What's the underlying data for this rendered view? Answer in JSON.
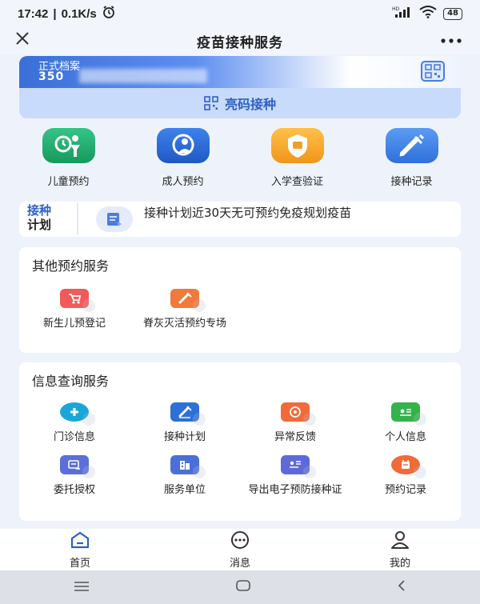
{
  "status": {
    "time": "17:42",
    "speed": "0.1K/s",
    "network": "HD",
    "battery": "48"
  },
  "nav": {
    "title": "疫苗接种服务"
  },
  "qr_card": {
    "archive_label": "正式档案",
    "archive_id": "350",
    "action_label": "亮码接种"
  },
  "main_services": [
    {
      "label": "儿童预约",
      "color": "#1fa86b"
    },
    {
      "label": "成人预约",
      "color": "#2c6fd6"
    },
    {
      "label": "入学查验证",
      "color": "#f2a623"
    },
    {
      "label": "接种记录",
      "color": "#3d86e8"
    }
  ],
  "plan": {
    "badge_line1": "接种",
    "badge_line2": "计划",
    "text": "接种计划近30天无可预约免疫规划疫苗"
  },
  "other_services": {
    "title": "其他预约服务",
    "items": [
      {
        "label": "新生儿预登记",
        "color": "#f25a5a"
      },
      {
        "label": "脊灰灭活预约专场",
        "color": "#f07a3a"
      }
    ]
  },
  "info_services": {
    "title": "信息查询服务",
    "items": [
      {
        "label": "门诊信息",
        "color": "#1aa6d9"
      },
      {
        "label": "接种计划",
        "color": "#2e6fd8"
      },
      {
        "label": "异常反馈",
        "color": "#f06a3a"
      },
      {
        "label": "个人信息",
        "color": "#33b34a"
      },
      {
        "label": "委托授权",
        "color": "#5b6fd9"
      },
      {
        "label": "服务单位",
        "color": "#4a6fd8"
      },
      {
        "label": "导出电子预防接种证",
        "color": "#5d6ad8"
      },
      {
        "label": "预约记录",
        "color": "#f06a3a"
      }
    ]
  },
  "tabs": [
    {
      "label": "首页"
    },
    {
      "label": "消息"
    },
    {
      "label": "我的"
    }
  ]
}
